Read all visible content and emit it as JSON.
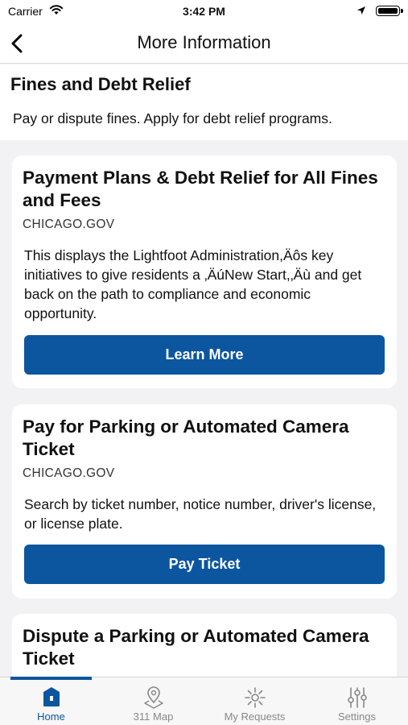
{
  "status_bar": {
    "carrier": "Carrier",
    "time": "3:42 PM"
  },
  "nav": {
    "title": "More Information"
  },
  "section": {
    "title": "Fines and Debt Relief",
    "subtitle": "Pay or dispute fines.  Apply for debt relief programs."
  },
  "cards": [
    {
      "title": "Payment Plans & Debt Relief for All Fines and Fees",
      "source": "CHICAGO.GOV",
      "description": "This displays the Lightfoot Administration,Äôs key initiatives to give residents a ‚ÄúNew Start,‚Äù and get back on the path to compliance and economic opportunity.",
      "button": "Learn More"
    },
    {
      "title": "Pay for Parking or Automated Camera Ticket",
      "source": "CHICAGO.GOV",
      "description": "Search by ticket number, notice number, driver's license, or license plate.",
      "button": "Pay Ticket"
    },
    {
      "title": "Dispute a Parking or Automated Camera Ticket"
    }
  ],
  "tabs": [
    {
      "label": "Home",
      "icon": "home-icon",
      "active": true
    },
    {
      "label": "311 Map",
      "icon": "map-pin-icon",
      "active": false
    },
    {
      "label": "My Requests",
      "icon": "requests-icon",
      "active": false
    },
    {
      "label": "Settings",
      "icon": "sliders-icon",
      "active": false
    }
  ],
  "colors": {
    "accent": "#0c56a0",
    "background": "#f2f2f4",
    "inactive_tab": "#888888"
  }
}
